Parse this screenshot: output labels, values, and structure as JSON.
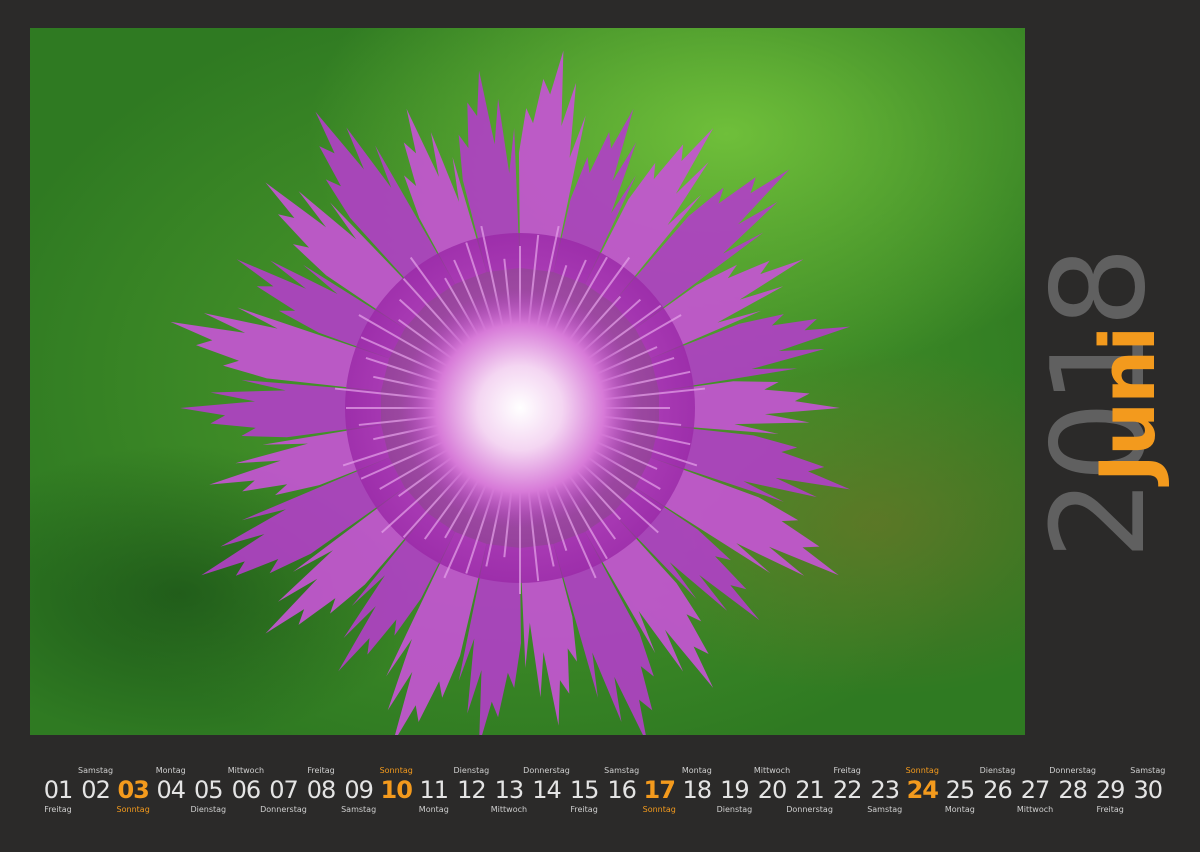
{
  "calendar": {
    "year": "2018",
    "month": "Juni",
    "colors": {
      "background": "#2b2a29",
      "accent": "#f39a1d",
      "year": "#606060",
      "text": "#e4e4e4"
    },
    "days": [
      {
        "num": "01",
        "name": "Freitag"
      },
      {
        "num": "02",
        "name": "Samstag"
      },
      {
        "num": "03",
        "name": "Sonntag",
        "sunday": true
      },
      {
        "num": "04",
        "name": "Montag"
      },
      {
        "num": "05",
        "name": "Dienstag"
      },
      {
        "num": "06",
        "name": "Mittwoch"
      },
      {
        "num": "07",
        "name": "Donnerstag"
      },
      {
        "num": "08",
        "name": "Freitag"
      },
      {
        "num": "09",
        "name": "Samstag"
      },
      {
        "num": "10",
        "name": "Sonntag",
        "sunday": true
      },
      {
        "num": "11",
        "name": "Montag"
      },
      {
        "num": "12",
        "name": "Dienstag"
      },
      {
        "num": "13",
        "name": "Mittwoch"
      },
      {
        "num": "14",
        "name": "Donnerstag"
      },
      {
        "num": "15",
        "name": "Freitag"
      },
      {
        "num": "16",
        "name": "Samstag"
      },
      {
        "num": "17",
        "name": "Sonntag",
        "sunday": true
      },
      {
        "num": "18",
        "name": "Montag"
      },
      {
        "num": "19",
        "name": "Dienstag"
      },
      {
        "num": "20",
        "name": "Mittwoch"
      },
      {
        "num": "21",
        "name": "Donnerstag"
      },
      {
        "num": "22",
        "name": "Freitag"
      },
      {
        "num": "23",
        "name": "Samstag"
      },
      {
        "num": "24",
        "name": "Sonntag",
        "sunday": true
      },
      {
        "num": "25",
        "name": "Montag"
      },
      {
        "num": "26",
        "name": "Dienstag"
      },
      {
        "num": "27",
        "name": "Mittwoch"
      },
      {
        "num": "28",
        "name": "Donnerstag"
      },
      {
        "num": "29",
        "name": "Freitag"
      },
      {
        "num": "30",
        "name": "Samstag"
      }
    ]
  }
}
